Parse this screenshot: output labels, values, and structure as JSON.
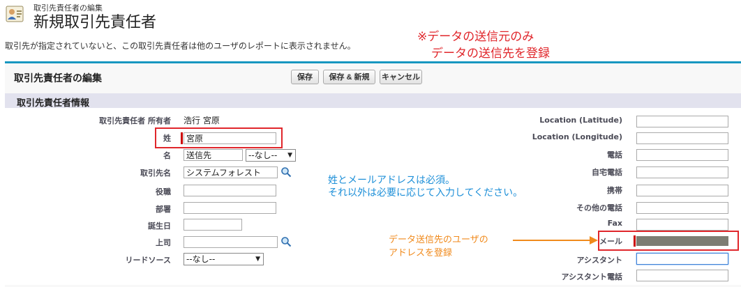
{
  "header": {
    "subtitle": "取引先責任者の編集",
    "title": "新規取引先責任者",
    "description": "取引先が指定されていないと、この取引先責任者は他のユーザのレポートに表示されません。"
  },
  "annotations": {
    "red_line1": "※データの送信元のみ",
    "red_line2": "データの送信先を登録",
    "blue_line1": "姓とメールアドレスは必須。",
    "blue_line2": "それ以外は必要に応じて入力してください。",
    "orange_line1": "データ送信先のユーザの",
    "orange_line2": "アドレスを登録"
  },
  "panel": {
    "title": "取引先責任者の編集",
    "save": "保存",
    "save_new": "保存 & 新規",
    "cancel": "キャンセル",
    "section_title": "取引先責任者情報"
  },
  "left": {
    "owner_label": "取引先責任者 所有者",
    "owner_value": "浩行 宮原",
    "last_name_label": "姓",
    "last_name_value": "宮原",
    "first_name_label": "名",
    "first_name_value": "送信先",
    "salutation_value": "--なし--",
    "account_label": "取引先名",
    "account_value": "システムフォレスト",
    "title_label": "役職",
    "department_label": "部署",
    "birthdate_label": "誕生日",
    "reports_to_label": "上司",
    "lead_source_label": "リードソース",
    "lead_source_value": "--なし--"
  },
  "right": {
    "latitude_label": "Location (Latitude)",
    "longitude_label": "Location (Longitude)",
    "phone_label": "電話",
    "home_phone_label": "自宅電話",
    "mobile_label": "携帯",
    "other_phone_label": "その他の電話",
    "fax_label": "Fax",
    "email_label": "メール",
    "assistant_label": "アシスタント",
    "assistant_phone_label": "アシスタント電話"
  }
}
